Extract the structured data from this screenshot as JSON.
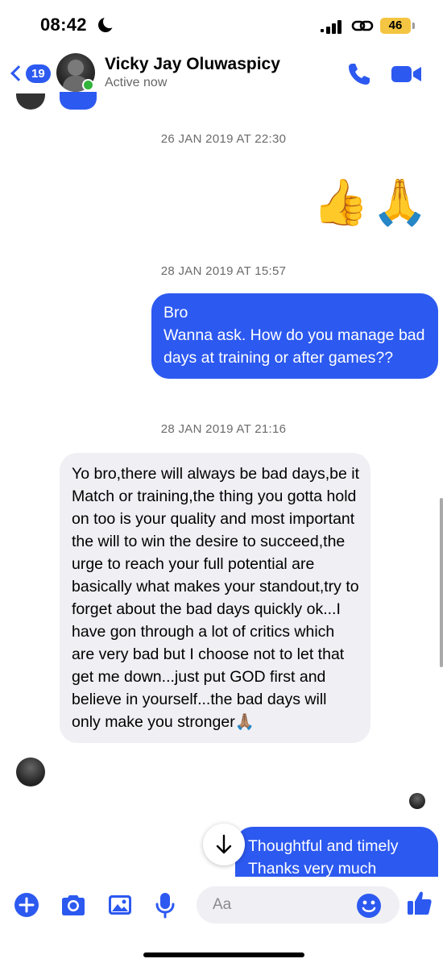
{
  "status_bar": {
    "time": "08:42",
    "battery": "46",
    "icons": [
      "moon-icon",
      "signal-icon",
      "link-icon",
      "battery-icon"
    ]
  },
  "header": {
    "back_count": "19",
    "contact_name": "Vicky Jay Oluwaspicy",
    "contact_status": "Active now",
    "icons": [
      "back-chevron-icon",
      "phone-icon",
      "video-camera-icon"
    ]
  },
  "messages": {
    "timestamp_1": "26 JAN 2019 AT 22:30",
    "emoji_message": "👍🙏",
    "timestamp_2": "28 JAN 2019 AT 15:57",
    "outgoing_1": "Bro\nWanna ask. How do you manage bad days at training or after games??",
    "timestamp_3": "28 JAN 2019 AT 21:16",
    "incoming_1": "Yo bro,there will always be bad days,be it Match or training,the thing you gotta hold on too is your quality and most important the will to win the desire to succeed,the urge to reach your full potential are basically what makes your standout,try to forget about the bad days quickly ok...I have gon through a lot of critics which are very bad but I choose not to let that get me down...just put GOD first and believe in yourself...the bad days will only make you stronger🙏🏽",
    "outgoing_2": "Thoughtful and timely\nThanks very much"
  },
  "composer": {
    "placeholder": "Aa",
    "icons": [
      "plus-icon",
      "camera-icon",
      "image-icon",
      "microphone-icon",
      "smiley-icon",
      "thumbs-up-icon"
    ]
  },
  "colors": {
    "accent": "#2c59f0",
    "incoming_bubble": "#efeff4",
    "online": "#31b43a",
    "battery": "#f4c542"
  }
}
